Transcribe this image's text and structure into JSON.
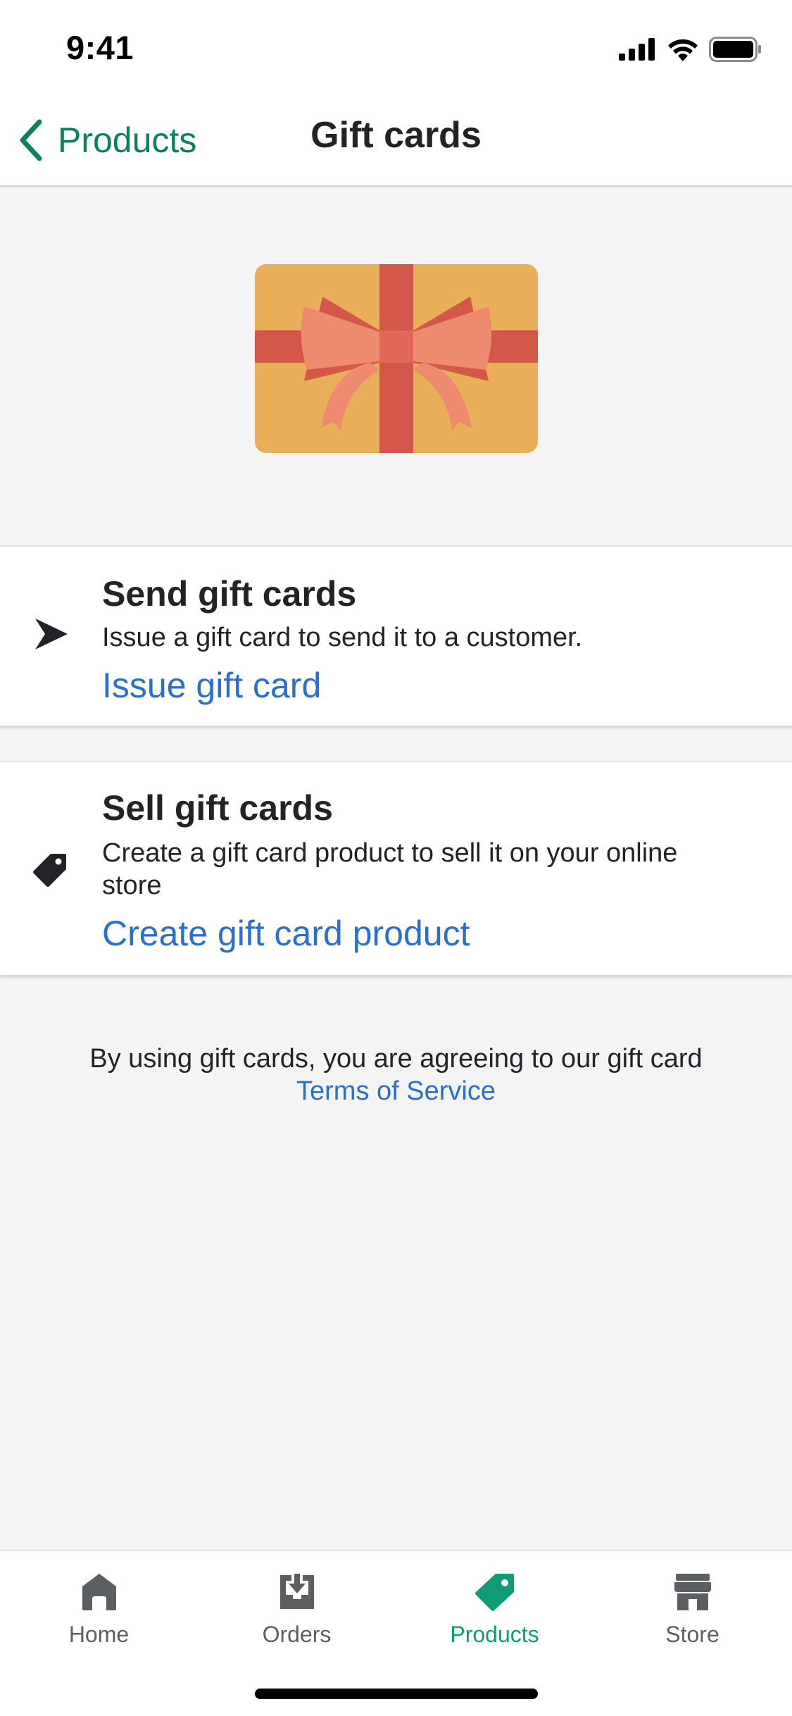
{
  "status_bar": {
    "time": "9:41",
    "icons": [
      "cellular-signal-icon",
      "wifi-icon",
      "battery-icon"
    ]
  },
  "nav": {
    "back_label": "Products",
    "title": "Gift cards"
  },
  "hero": {
    "illustration": "gift-card-illustration"
  },
  "send_card": {
    "icon": "send-arrow-icon",
    "title": "Send gift cards",
    "description": "Issue a gift card to send it to a customer.",
    "link": "Issue gift card"
  },
  "sell_card": {
    "icon": "price-tag-icon",
    "title": "Sell gift cards",
    "description": "Create a gift card product to sell it on your online store",
    "link": "Create gift card product"
  },
  "terms": {
    "text": "By using gift cards, you are agreeing to our gift card",
    "link": "Terms of Service"
  },
  "tabs": [
    {
      "label": "Home",
      "icon": "home-icon",
      "active": false
    },
    {
      "label": "Orders",
      "icon": "orders-icon",
      "active": false
    },
    {
      "label": "Products",
      "icon": "tag-icon",
      "active": true
    },
    {
      "label": "Store",
      "icon": "store-icon",
      "active": false
    }
  ],
  "colors": {
    "accent_green": "#0e8060",
    "active_tab": "#0e9c74",
    "link_blue": "#2c6ecb",
    "card_gold": "#e9b059",
    "ribbon_red": "#d4584a",
    "bow_salmon": "#ee8a70"
  }
}
